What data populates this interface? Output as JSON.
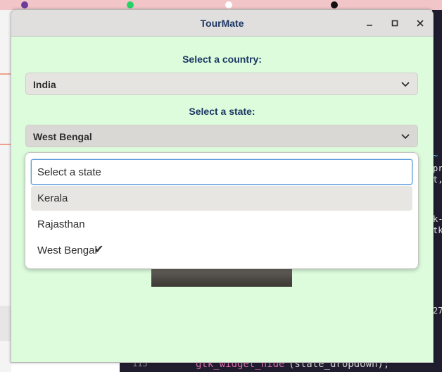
{
  "window": {
    "title": "TourMate"
  },
  "country": {
    "label": "Select a country:",
    "selected": "India"
  },
  "state": {
    "label": "Select a state:",
    "selected": "West Bengal",
    "search_placeholder": "Select a state",
    "options": [
      {
        "label": "Kerala",
        "highlighted": true,
        "checked": false
      },
      {
        "label": "Rajasthan",
        "highlighted": false,
        "checked": false
      },
      {
        "label": "West Bengal",
        "highlighted": false,
        "checked": true
      }
    ]
  },
  "background": {
    "code_line_number": "115",
    "code_function": "gtk_widget_hide",
    "code_args": "(state_dropdown);"
  },
  "colors": {
    "window_bg": "#dcfcdc",
    "title_text": "#1d3763",
    "focus_border": "#5b9ad9"
  },
  "icons": [
    "minimize-icon",
    "maximize-icon",
    "close-icon",
    "chevron-down-icon",
    "checkmark-icon"
  ]
}
